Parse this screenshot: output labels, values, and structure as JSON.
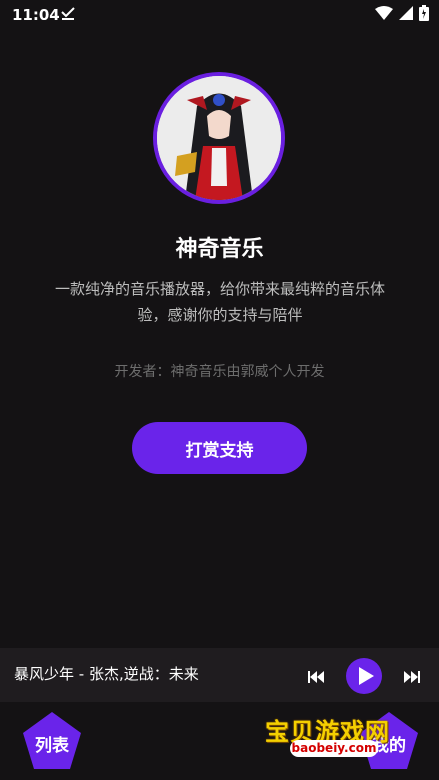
{
  "status_bar": {
    "time": "11:04",
    "icons": [
      "download-done-icon",
      "wifi-icon",
      "signal-icon",
      "battery-icon"
    ]
  },
  "app": {
    "name": "神奇音乐",
    "description": "一款纯净的音乐播放器，给你带来最纯粹的音乐体验，感谢你的支持与陪伴",
    "developer": "开发者：神奇音乐由郭威个人开发",
    "donate_label": "打赏支持"
  },
  "player": {
    "now_playing": "暴风少年 - 张杰,逆战：未来",
    "controls": [
      "previous-icon",
      "play-icon",
      "next-icon"
    ]
  },
  "bottom_nav": {
    "left_label": "列表",
    "right_label": "我的"
  },
  "watermark": {
    "text": "宝贝游戏网",
    "url": "baobeiy.com"
  },
  "colors": {
    "background": "#141214",
    "accent": "#6a24ea",
    "player_bar": "#1f1c1f",
    "muted_text": "#6d6d6d",
    "desc_text": "#bdbdbd"
  }
}
